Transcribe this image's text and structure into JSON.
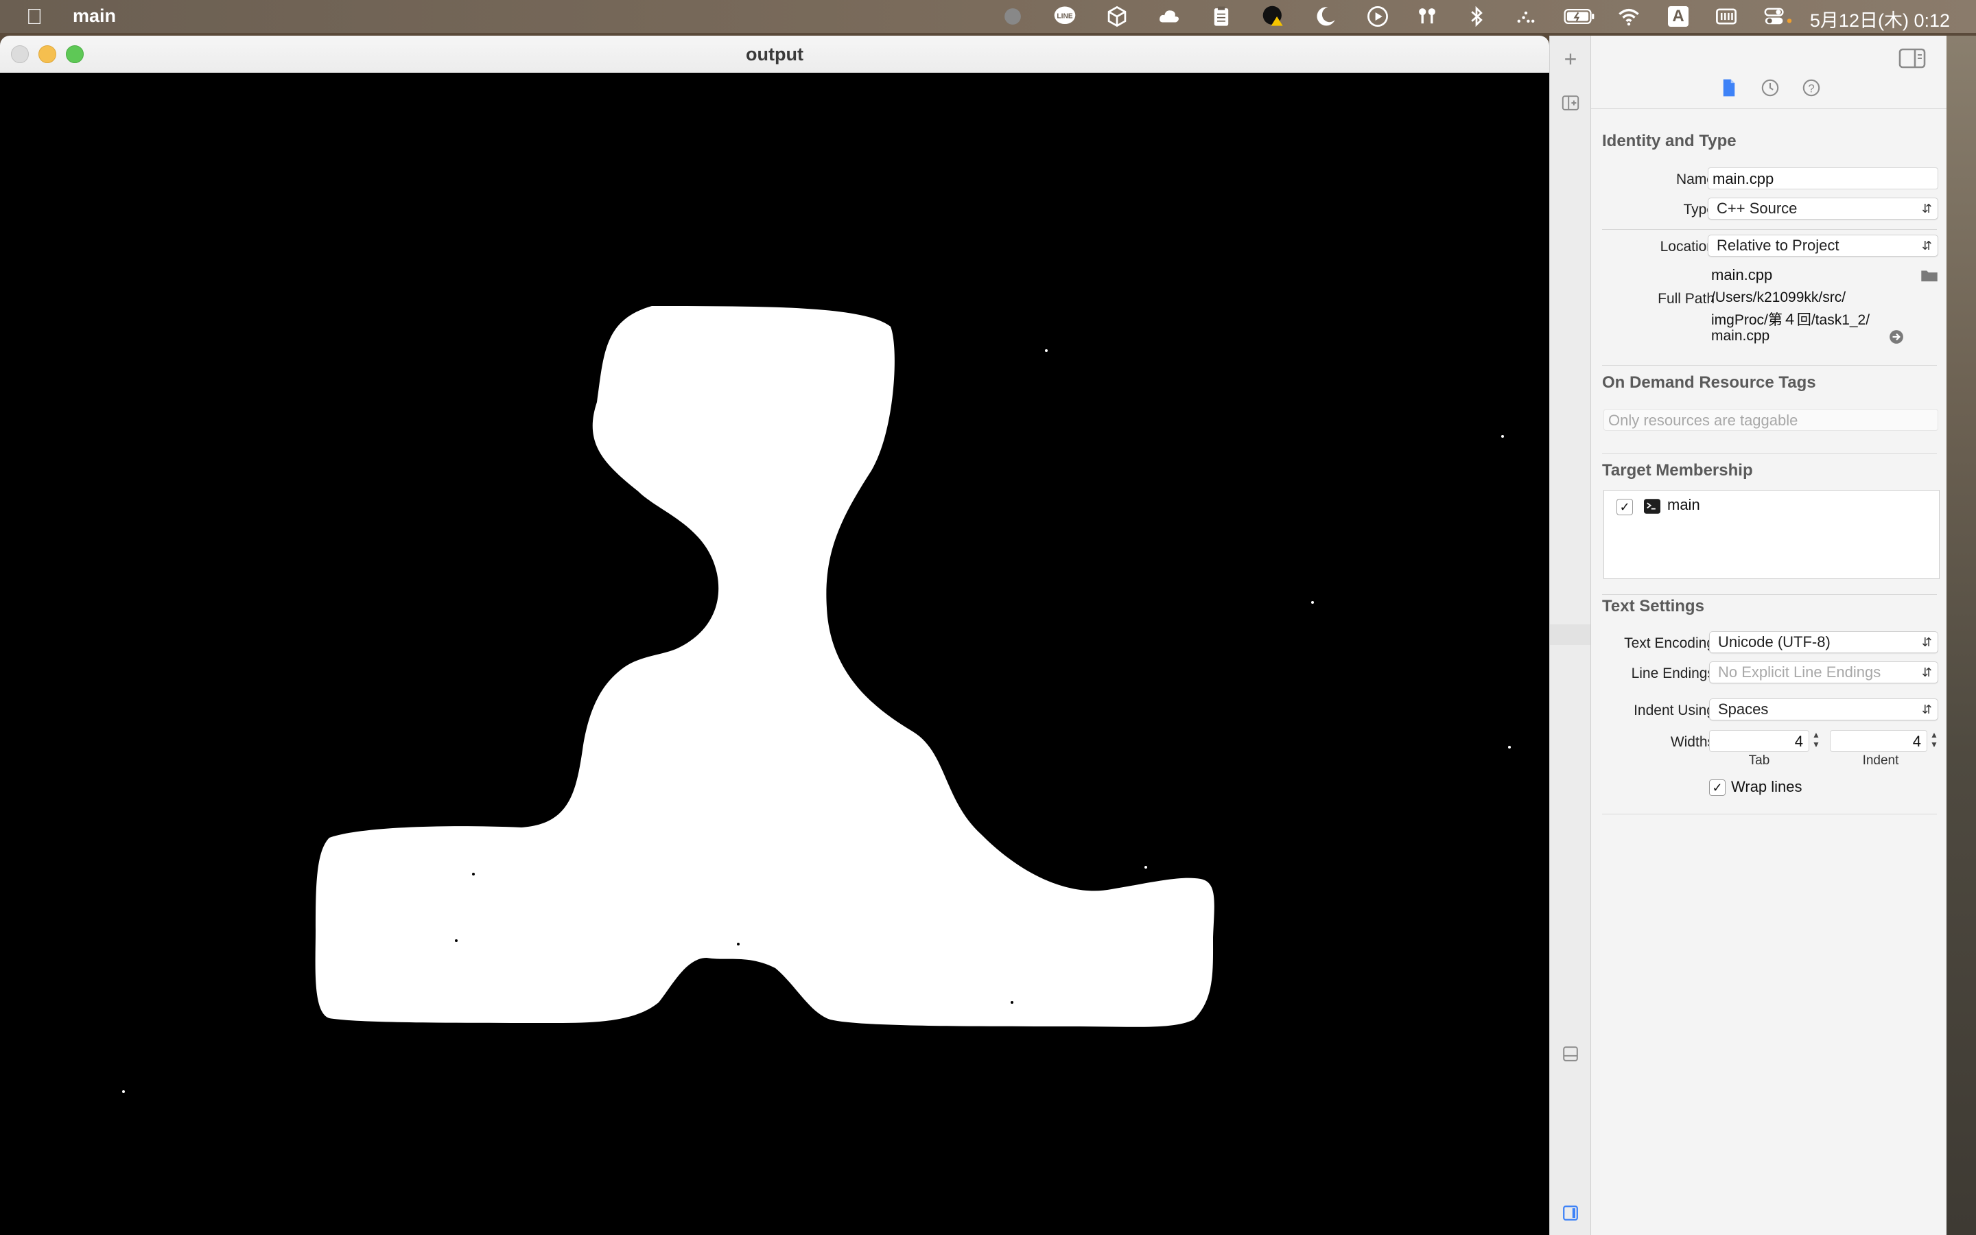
{
  "menubar": {
    "app_name": "main",
    "clock": "5月12日(木) 0:12",
    "status_icons": [
      "record-icon",
      "line-icon",
      "box-icon",
      "cloud-icon",
      "clipboard-icon",
      "warning-profile-icon",
      "moon-icon",
      "play-icon",
      "airpods-icon",
      "bluetooth-icon",
      "dots-icon",
      "battery-icon",
      "wifi-icon",
      "input-source-icon",
      "keyboard-icon",
      "control-center-icon"
    ],
    "input_source_label": "A"
  },
  "output_window": {
    "title": "output",
    "image_description_colors": {
      "background": "#000000",
      "shape": "#ffffff"
    }
  },
  "inspector": {
    "identity": {
      "title": "Identity and Type",
      "name_label": "Name",
      "name_value": "main.cpp",
      "type_label": "Type",
      "type_value": "C++ Source",
      "location_label": "Location",
      "location_value": "Relative to Project",
      "location_file": "main.cpp",
      "full_path_label": "Full Path",
      "full_path_line1": "/Users/k21099kk/src/",
      "full_path_line2": "imgProc/第４回/task1_2/",
      "full_path_line3": "main.cpp"
    },
    "on_demand": {
      "title": "On Demand Resource Tags",
      "placeholder": "Only resources are taggable"
    },
    "target": {
      "title": "Target Membership",
      "items": [
        {
          "label": "main",
          "checked": true
        }
      ]
    },
    "text_settings": {
      "title": "Text Settings",
      "encoding_label": "Text Encoding",
      "encoding_value": "Unicode (UTF-8)",
      "line_endings_label": "Line Endings",
      "line_endings_value": "No Explicit Line Endings",
      "indent_using_label": "Indent Using",
      "indent_using_value": "Spaces",
      "widths_label": "Widths",
      "tab_value": "4",
      "indent_value": "4",
      "tab_caption": "Tab",
      "indent_caption": "Indent",
      "wrap_label": "Wrap lines",
      "wrap_checked": true
    }
  },
  "colors": {
    "accent": "#3e82f7",
    "traffic_close": "#dcdcdc",
    "traffic_min": "#f5bf4f",
    "traffic_max": "#5ec856"
  }
}
